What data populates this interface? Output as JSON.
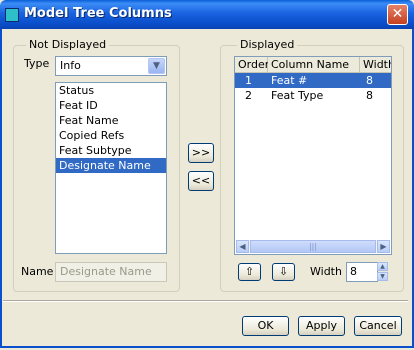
{
  "window": {
    "title": "Model Tree Columns",
    "close_symbol": "✕",
    "icon": "app-window-icon"
  },
  "not_displayed": {
    "group_label": "Not Displayed",
    "type_label": "Type",
    "type_value": "Info",
    "items": [
      "Status",
      "Feat ID",
      "Feat Name",
      "Copied Refs",
      "Feat Subtype",
      "Designate Name"
    ],
    "selected_index": 5,
    "name_label": "Name",
    "name_value": "Designate Name"
  },
  "transfer": {
    "add_label": ">>",
    "remove_label": "<<"
  },
  "displayed": {
    "group_label": "Displayed",
    "columns": [
      "Order",
      "Column Name",
      "Width"
    ],
    "rows": [
      {
        "order": "1",
        "name": "Feat #",
        "width": "8"
      },
      {
        "order": "2",
        "name": "Feat Type",
        "width": "8"
      }
    ],
    "selected_index": 0,
    "width_label": "Width",
    "width_value": "8"
  },
  "buttons": {
    "ok": "OK",
    "apply": "Apply",
    "cancel": "Cancel"
  }
}
